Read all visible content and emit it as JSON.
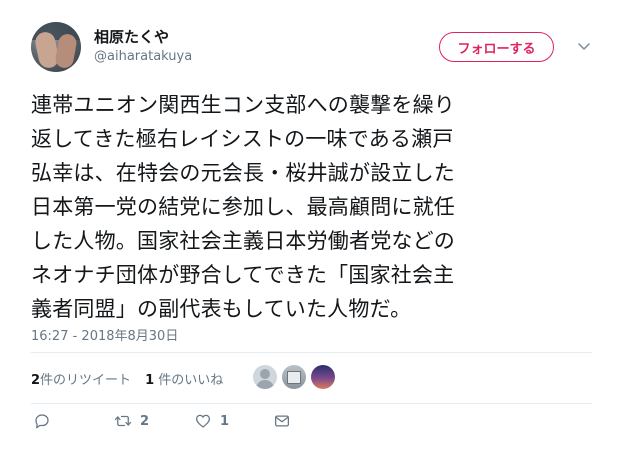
{
  "author": {
    "display_name": "相原たくや",
    "handle": "@aiharatakuya"
  },
  "follow_button": {
    "label": "フォローする"
  },
  "tweet": {
    "text": "連帯ユニオン関西生コン支部への襲撃を繰り\n返してきた極右レイシストの一味である瀬戸\n弘幸は、在特会の元会長・桜井誠が設立した\n日本第一党の結党に参加し、最高顧問に就任\nした人物。国家社会主義日本労働者党などの\nネオナチ団体が野合してできた「国家社会主\n義者同盟」の副代表もしていた人物だ。",
    "timestamp": "16:27 - 2018年8月30日"
  },
  "stats": {
    "retweets_count": "2",
    "retweets_label": "件のリツイート",
    "likes_count": "1",
    "likes_label": "件のいいね"
  },
  "actions": {
    "retweet_count": "2",
    "like_count": "1"
  },
  "colors": {
    "accent": "#e0245e",
    "secondary_text": "#657786",
    "divider": "#e6ecf0"
  },
  "icons": [
    "chevron-down-icon",
    "reply-icon",
    "retweet-icon",
    "heart-icon",
    "direct-message-icon"
  ]
}
